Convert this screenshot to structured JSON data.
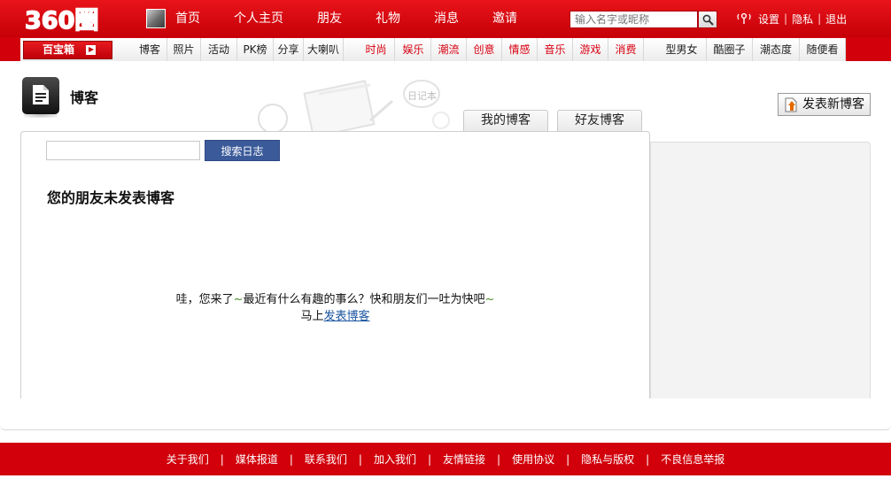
{
  "brand": {
    "logo_text": "360圈",
    "accent_color": "#d1000b"
  },
  "top_nav": {
    "items": [
      "首页",
      "个人主页",
      "朋友",
      "礼物",
      "消息",
      "邀请"
    ]
  },
  "search": {
    "placeholder": "输入名字或昵称",
    "icon": "search-icon"
  },
  "user_links": {
    "settings": "设置",
    "privacy": "隐私",
    "logout": "退出",
    "separator": "|"
  },
  "sub_nav": {
    "treasure_box": "百宝箱",
    "items": [
      {
        "label": "博客",
        "color": "dark"
      },
      {
        "label": "照片",
        "color": "dark"
      },
      {
        "label": "活动",
        "color": "dark"
      },
      {
        "label": "PK榜",
        "color": "dark"
      },
      {
        "label": "分享",
        "color": "dark"
      },
      {
        "label": "大喇叭",
        "color": "dark"
      },
      {
        "label": "时尚",
        "color": "red"
      },
      {
        "label": "娱乐",
        "color": "red"
      },
      {
        "label": "潮流",
        "color": "red"
      },
      {
        "label": "创意",
        "color": "red"
      },
      {
        "label": "情感",
        "color": "red"
      },
      {
        "label": "音乐",
        "color": "red"
      },
      {
        "label": "游戏",
        "color": "red"
      },
      {
        "label": "消费",
        "color": "red"
      },
      {
        "label": "型男女",
        "color": "dark"
      },
      {
        "label": "酷圈子",
        "color": "dark"
      },
      {
        "label": "潮态度",
        "color": "dark"
      },
      {
        "label": "随便看",
        "color": "dark"
      }
    ]
  },
  "blog": {
    "title": "博客",
    "deco_text": "日记本",
    "tabs": [
      "我的博客",
      "好友博客"
    ],
    "new_post_label": "发表新博客",
    "search_button": "搜索日志",
    "empty_title": "您的朋友未发表博客",
    "message_part1": "哇，您来了",
    "message_part2": "最近有什么有趣的事么？快和朋友们一吐为快吧",
    "tilde": "~",
    "cta_prefix": "马上",
    "cta_link": "发表博客"
  },
  "footer": {
    "links": [
      "关于我们",
      "媒体报道",
      "联系我们",
      "加入我们",
      "友情链接",
      "使用协议",
      "隐私与版权",
      "不良信息举报"
    ],
    "separator": "|"
  }
}
